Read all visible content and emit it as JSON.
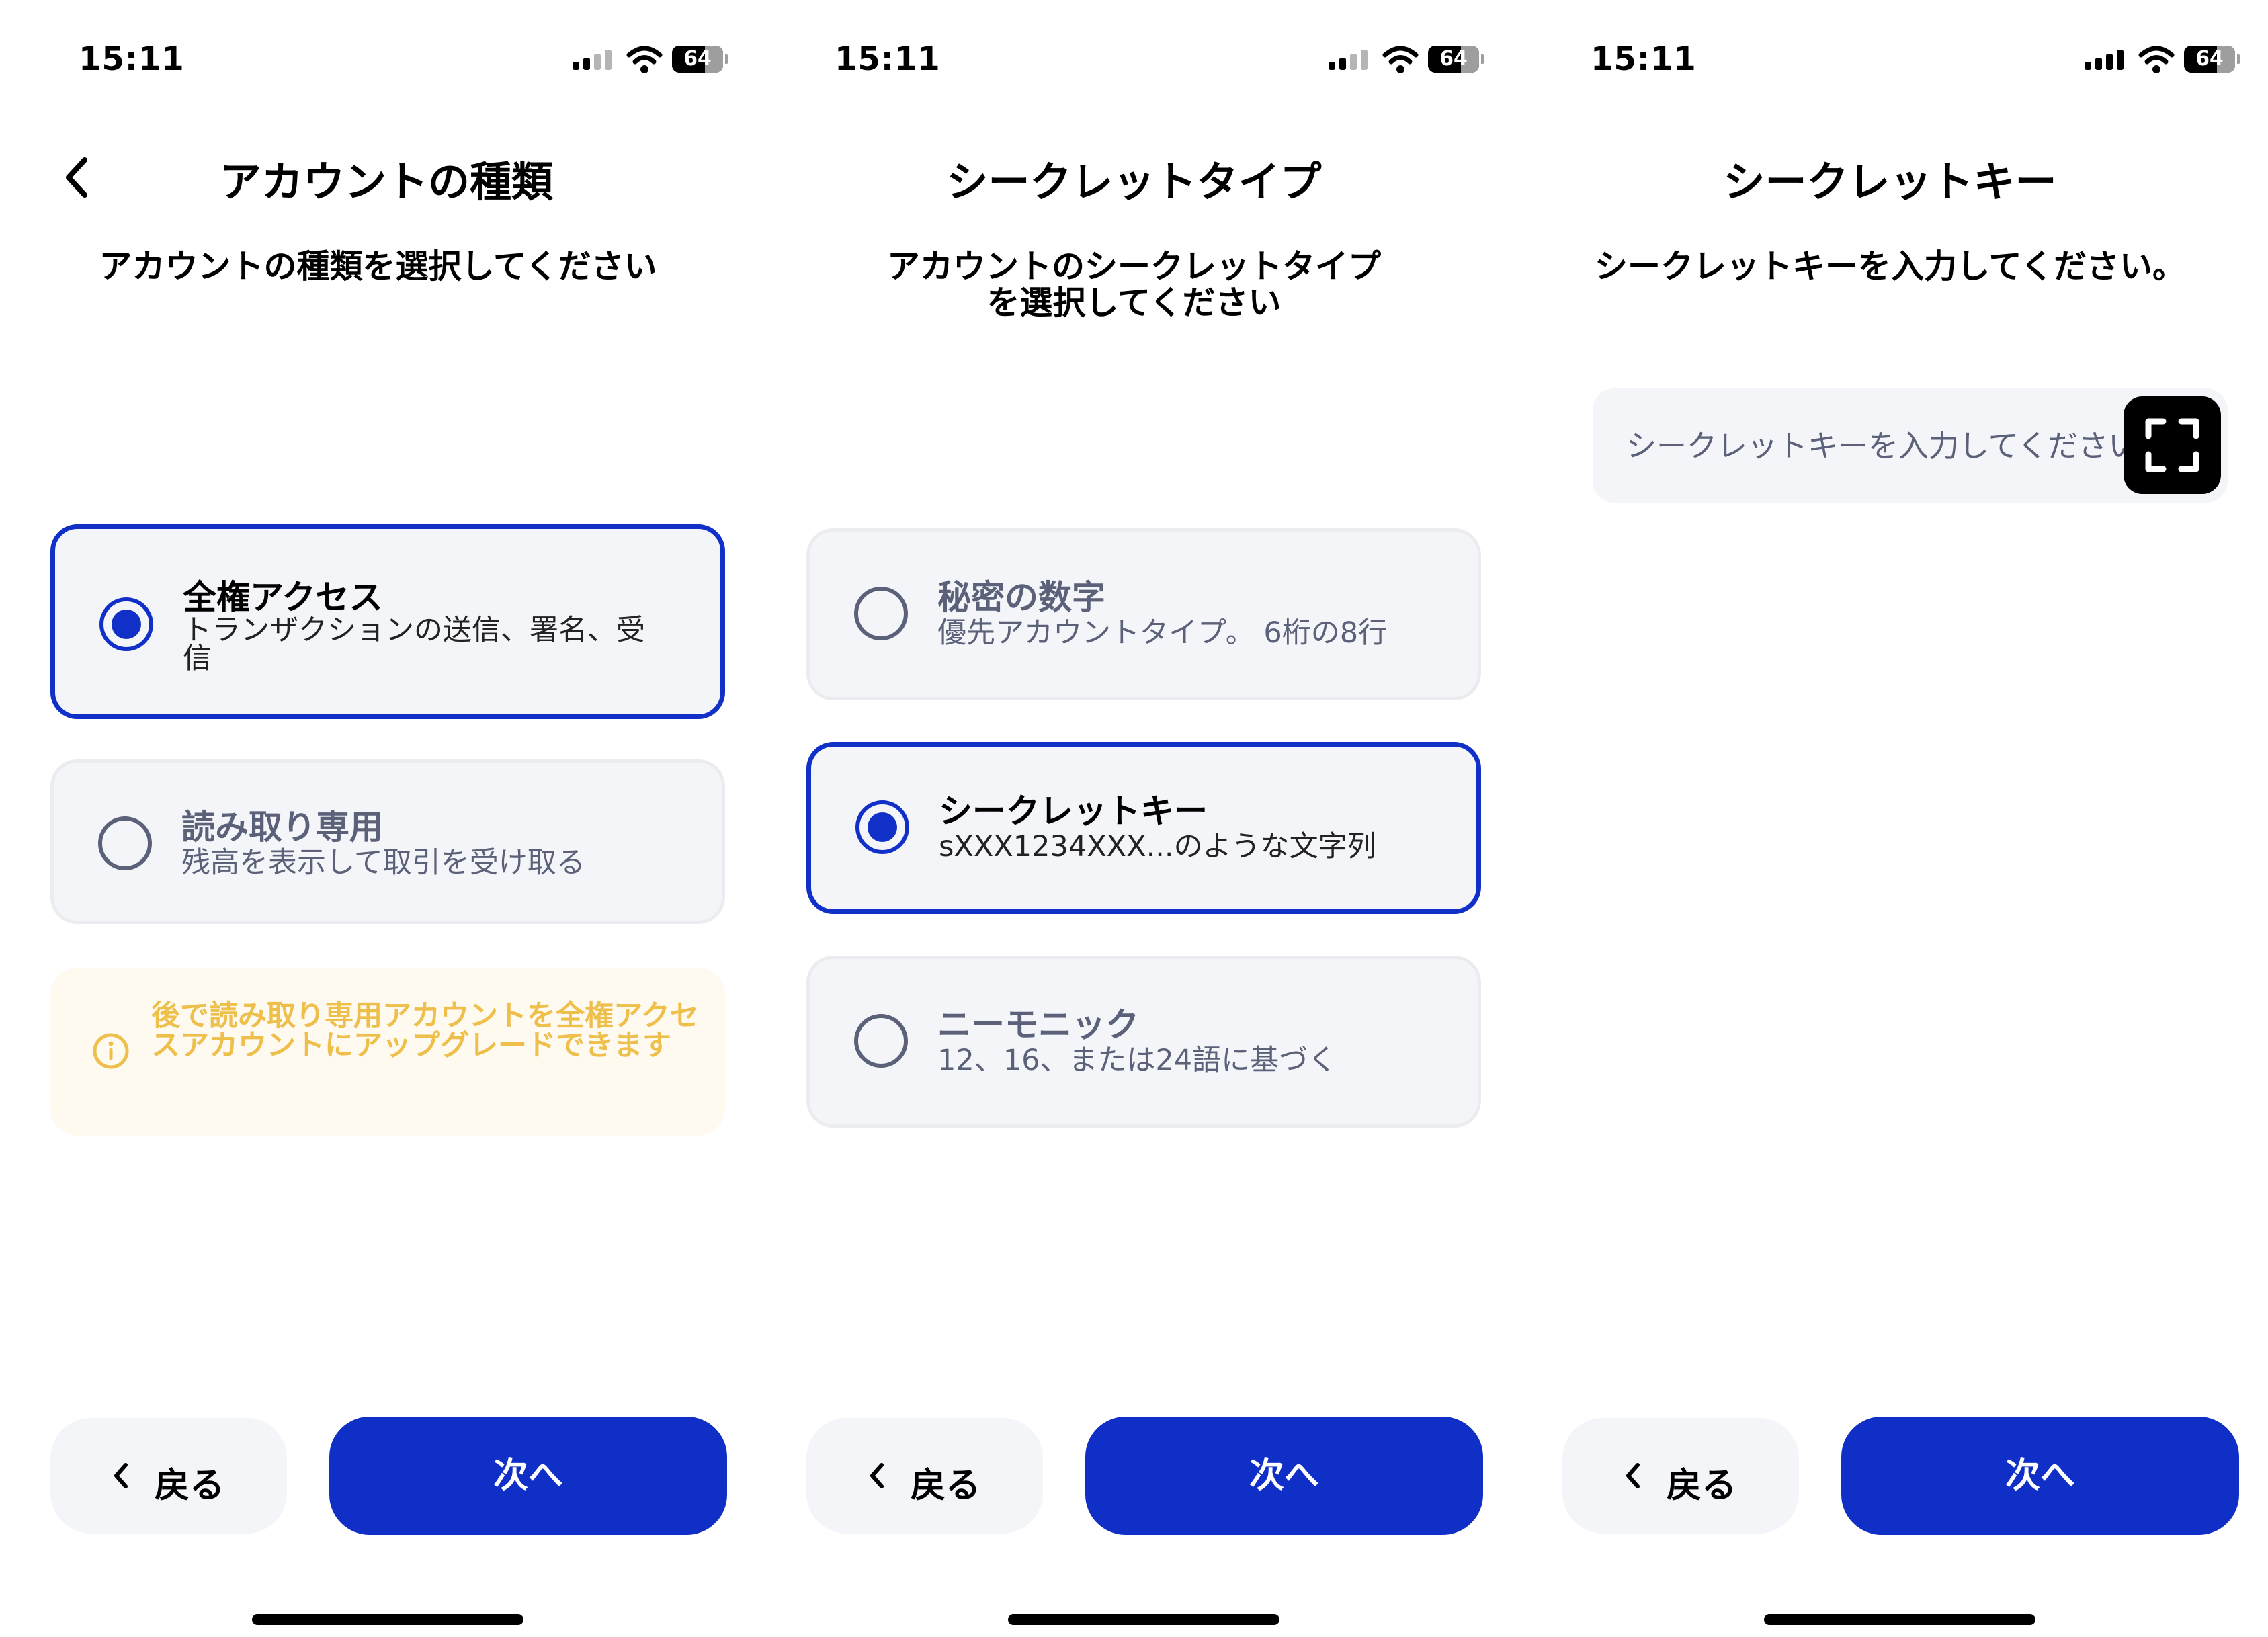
{
  "status_bar": {
    "time": "15:11",
    "battery": "64",
    "battery_level": 0.64
  },
  "colors": {
    "accent": "#1130c8",
    "button_primary": "#0f2fc6",
    "card_bg": "#f4f5f9",
    "notice_text": "#efbf4c",
    "notice_bg": "#fefaf0",
    "muted": "#5a6178"
  },
  "screens": [
    {
      "title": "アカウントの種類",
      "subtitle": "アカウントの種類を選択してください",
      "options": [
        {
          "title": "全権アクセス",
          "description": "トランザクションの送信、署名、受信",
          "selected": true
        },
        {
          "title": "読み取り専用",
          "description": "残高を表示して取引を受け取る",
          "selected": false
        }
      ],
      "notice": {
        "icon": "info-icon",
        "text": "後で読み取り専用アカウントを全権アクセスアカウントにアップグレードできます"
      },
      "back_label": "戻る",
      "next_label": "次へ"
    },
    {
      "title": "シークレットタイプ",
      "subtitle": "アカウントのシークレットタイプを選択してください",
      "options": [
        {
          "title": "秘密の数字",
          "description": "優先アカウントタイプ。 6桁の8行",
          "selected": false
        },
        {
          "title": "シークレットキー",
          "description": "sXXX1234XXX...のような文字列",
          "selected": true
        },
        {
          "title": "ニーモニック",
          "description": "12、16、または24語に基づく",
          "selected": false
        }
      ],
      "back_label": "戻る",
      "next_label": "次へ"
    },
    {
      "title": "シークレットキー",
      "subtitle": "シークレットキーを入力してください。",
      "input": {
        "placeholder": "シークレットキーを入力してください",
        "value": ""
      },
      "scan_icon": "scan-qr-icon",
      "back_label": "戻る",
      "next_label": "次へ"
    }
  ]
}
